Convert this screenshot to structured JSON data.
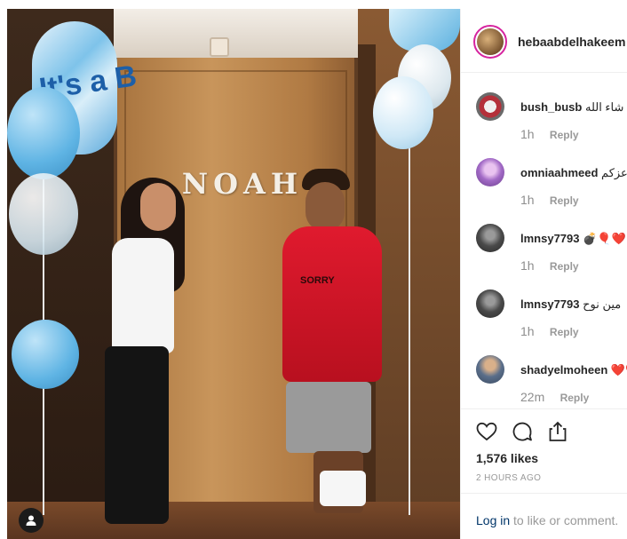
{
  "post": {
    "author": "hebaabdelhakeem",
    "author_suffix": " •",
    "door_sign": "NOAH",
    "balloon_text": "It's a B",
    "hoodie_text": "SORRY"
  },
  "comments": [
    {
      "user": "bush_busb",
      "text": "ان شاء الله",
      "time": "1h",
      "reply": "Reply",
      "avatar_color": "#b4303a"
    },
    {
      "user": "omniaahmeed",
      "text": "عزكم",
      "time": "1h",
      "reply": "Reply",
      "avatar_color": "#a26ac6"
    },
    {
      "user": "lmnsy7793",
      "text": "💣🎈❤️",
      "time": "1h",
      "reply": "Reply",
      "avatar_color": "#4a4a4a"
    },
    {
      "user": "lmnsy7793",
      "text": "مين نوح",
      "time": "1h",
      "reply": "Reply",
      "avatar_color": "#4a4a4a"
    },
    {
      "user": "shadyelmoheen",
      "text": "❤️❤️",
      "time": "22m",
      "reply": "Reply",
      "avatar_color": "#5a6e8a"
    }
  ],
  "icons": {
    "like": "heart-icon",
    "comment": "comment-icon",
    "share": "share-icon",
    "user_tag": "user-icon"
  },
  "likes": "1,576 likes",
  "time_ago": "2 HOURS AGO",
  "login": {
    "link": "Log in",
    "rest": " to like or comment."
  },
  "colors": {
    "link": "#003569",
    "muted": "#999999",
    "story_ring": "#d6249f"
  }
}
